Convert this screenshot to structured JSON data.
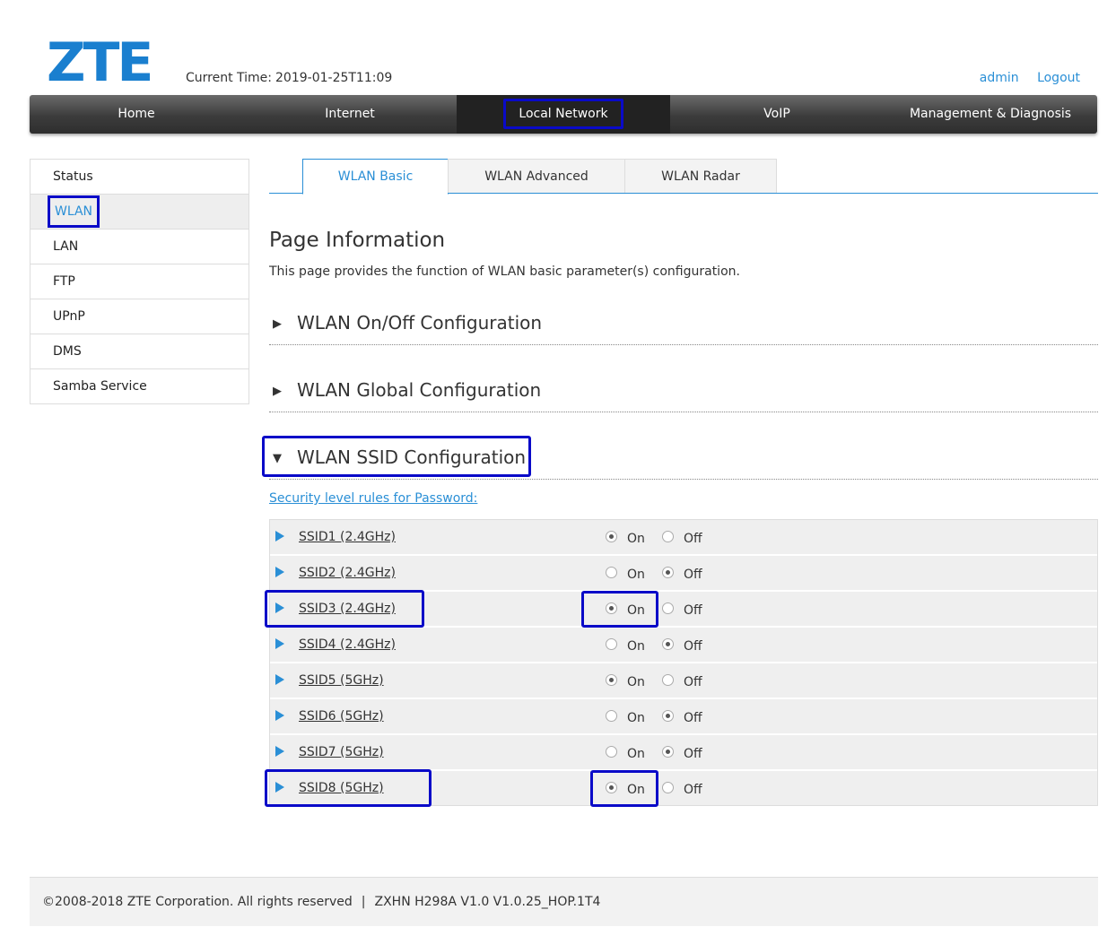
{
  "header": {
    "logo": "ZTE",
    "current_time_label": "Current Time:",
    "current_time_value": "2019-01-25T11:09",
    "user": "admin",
    "logout": "Logout"
  },
  "topnav": [
    {
      "label": "Home"
    },
    {
      "label": "Internet"
    },
    {
      "label": "Local Network",
      "active": true
    },
    {
      "label": "VoIP"
    },
    {
      "label": "Management & Diagnosis"
    }
  ],
  "sidebar": [
    {
      "label": "Status"
    },
    {
      "label": "WLAN",
      "active": true
    },
    {
      "label": "LAN"
    },
    {
      "label": "FTP"
    },
    {
      "label": "UPnP"
    },
    {
      "label": "DMS"
    },
    {
      "label": "Samba Service"
    }
  ],
  "tabs": [
    {
      "label": "WLAN Basic",
      "active": true
    },
    {
      "label": "WLAN Advanced"
    },
    {
      "label": "WLAN Radar"
    }
  ],
  "page": {
    "title": "Page Information",
    "description": "This page provides the function of WLAN basic parameter(s) configuration."
  },
  "sections": [
    {
      "label": "WLAN On/Off Configuration",
      "expanded": false
    },
    {
      "label": "WLAN Global Configuration",
      "expanded": false
    },
    {
      "label": "WLAN SSID Configuration",
      "expanded": true
    }
  ],
  "security_link": "Security level rules for Password:",
  "radio_labels": {
    "on": "On",
    "off": "Off"
  },
  "ssids": [
    {
      "name": "SSID1 (2.4GHz)",
      "enabled": true
    },
    {
      "name": "SSID2 (2.4GHz)",
      "enabled": false
    },
    {
      "name": "SSID3 (2.4GHz)",
      "enabled": true
    },
    {
      "name": "SSID4 (2.4GHz)",
      "enabled": false
    },
    {
      "name": "SSID5 (5GHz)",
      "enabled": true
    },
    {
      "name": "SSID6 (5GHz)",
      "enabled": false
    },
    {
      "name": "SSID7 (5GHz)",
      "enabled": false
    },
    {
      "name": "SSID8 (5GHz)",
      "enabled": true
    }
  ],
  "footer": {
    "copyright": "©2008-2018 ZTE Corporation. All rights reserved",
    "separator": "|",
    "version": "ZXHN H298A V1.0 V1.0.25_HOP.1T4"
  },
  "colors": {
    "brand": "#1a7fcf",
    "link": "#2a8fd6",
    "highlight": "#0a0ac8"
  }
}
